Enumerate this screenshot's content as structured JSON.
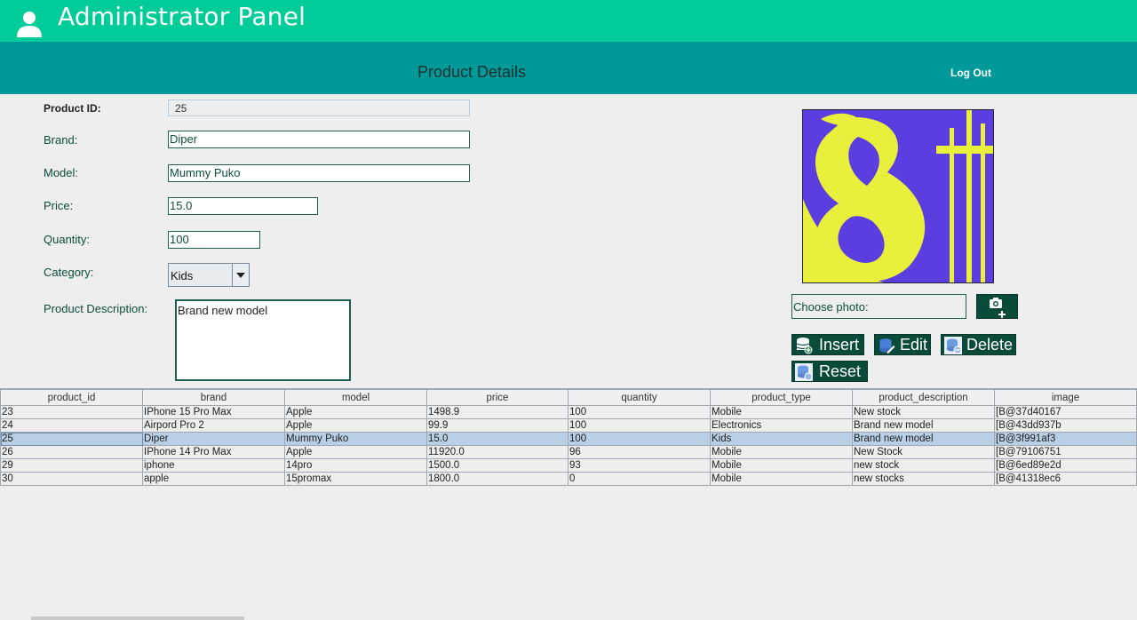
{
  "app": {
    "title": "Administrator Panel",
    "icon": "user-icon"
  },
  "header": {
    "heading": "Product Details",
    "logout_label": "Log Out"
  },
  "form": {
    "product_id_label": "Product ID:",
    "product_id_value": "25",
    "brand_label": "Brand:",
    "brand_value": "Diper",
    "model_label": "Model:",
    "model_value": "Mummy Puko",
    "price_label": "Price:",
    "price_value": "15.0",
    "quantity_label": "Quantity:",
    "quantity_value": "100",
    "category_label": "Category:",
    "category_value": "Kids",
    "description_label": "Product Description:",
    "description_value": "Brand new model"
  },
  "photo": {
    "choose_label": "Choose photo:",
    "upload_icon": "camera-add-icon",
    "colors": {
      "background": "#5c3ee0",
      "glyph": "#e8f03c"
    }
  },
  "actions": {
    "insert_label": "Insert",
    "edit_label": "Edit",
    "delete_label": "Delete",
    "reset_label": "Reset"
  },
  "table": {
    "headers": [
      "product_id",
      "brand",
      "model",
      "price",
      "quantity",
      "product_type",
      "product_description",
      "image"
    ],
    "rows": [
      [
        "23",
        "IPhone 15 Pro Max",
        "Apple",
        "1498.9",
        "100",
        "Mobile",
        "New stock",
        "[B@37d40167"
      ],
      [
        "24",
        "Airpord Pro 2",
        "Apple",
        "99.9",
        "100",
        "Electronics",
        "Brand new model",
        "[B@43dd937b"
      ],
      [
        "25",
        "Diper",
        "Mummy Puko",
        "15.0",
        "100",
        "Kids",
        "Brand new model",
        "[B@3f991af3"
      ],
      [
        "26",
        "IPhone 14 Pro Max",
        "Apple",
        "11920.0",
        "96",
        "Mobile",
        "New Stock",
        "[B@79106751"
      ],
      [
        "29",
        "iphone",
        "14pro",
        "1500.0",
        "93",
        "Mobile",
        "new stock",
        "[B@6ed89e2d"
      ],
      [
        "30",
        "apple",
        "15promax",
        "1800.0",
        "0",
        "Mobile",
        "new stocks",
        "[B@41318ec6"
      ]
    ],
    "selected_row": 2
  },
  "colors": {
    "banner": "#00cc99",
    "subheader": "#009999",
    "button": "#0a4a3a",
    "selection": "#b8cfe5"
  }
}
